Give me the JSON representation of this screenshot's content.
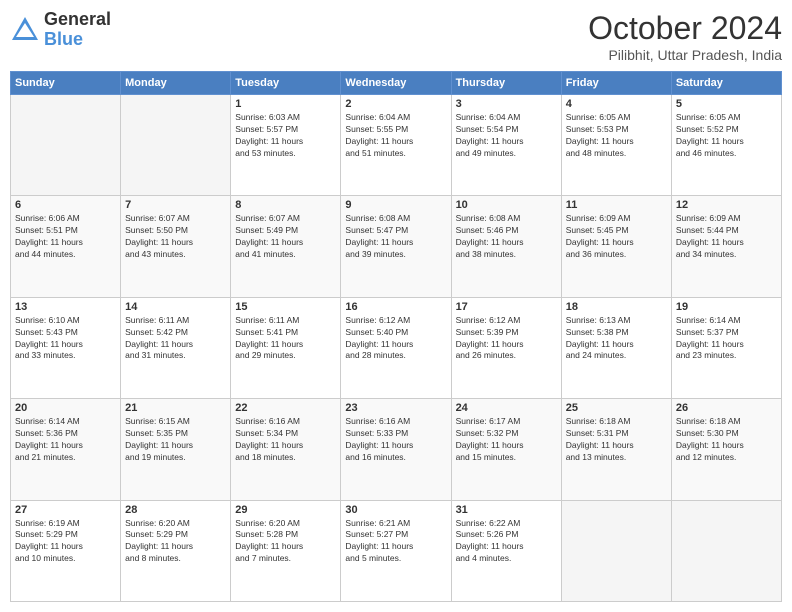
{
  "logo": {
    "general": "General",
    "blue": "Blue"
  },
  "title": "October 2024",
  "subtitle": "Pilibhit, Uttar Pradesh, India",
  "days": [
    "Sunday",
    "Monday",
    "Tuesday",
    "Wednesday",
    "Thursday",
    "Friday",
    "Saturday"
  ],
  "weeks": [
    [
      {
        "day": "",
        "empty": true
      },
      {
        "day": "",
        "empty": true
      },
      {
        "day": "1",
        "line1": "Sunrise: 6:03 AM",
        "line2": "Sunset: 5:57 PM",
        "line3": "Daylight: 11 hours",
        "line4": "and 53 minutes."
      },
      {
        "day": "2",
        "line1": "Sunrise: 6:04 AM",
        "line2": "Sunset: 5:55 PM",
        "line3": "Daylight: 11 hours",
        "line4": "and 51 minutes."
      },
      {
        "day": "3",
        "line1": "Sunrise: 6:04 AM",
        "line2": "Sunset: 5:54 PM",
        "line3": "Daylight: 11 hours",
        "line4": "and 49 minutes."
      },
      {
        "day": "4",
        "line1": "Sunrise: 6:05 AM",
        "line2": "Sunset: 5:53 PM",
        "line3": "Daylight: 11 hours",
        "line4": "and 48 minutes."
      },
      {
        "day": "5",
        "line1": "Sunrise: 6:05 AM",
        "line2": "Sunset: 5:52 PM",
        "line3": "Daylight: 11 hours",
        "line4": "and 46 minutes."
      }
    ],
    [
      {
        "day": "6",
        "line1": "Sunrise: 6:06 AM",
        "line2": "Sunset: 5:51 PM",
        "line3": "Daylight: 11 hours",
        "line4": "and 44 minutes."
      },
      {
        "day": "7",
        "line1": "Sunrise: 6:07 AM",
        "line2": "Sunset: 5:50 PM",
        "line3": "Daylight: 11 hours",
        "line4": "and 43 minutes."
      },
      {
        "day": "8",
        "line1": "Sunrise: 6:07 AM",
        "line2": "Sunset: 5:49 PM",
        "line3": "Daylight: 11 hours",
        "line4": "and 41 minutes."
      },
      {
        "day": "9",
        "line1": "Sunrise: 6:08 AM",
        "line2": "Sunset: 5:47 PM",
        "line3": "Daylight: 11 hours",
        "line4": "and 39 minutes."
      },
      {
        "day": "10",
        "line1": "Sunrise: 6:08 AM",
        "line2": "Sunset: 5:46 PM",
        "line3": "Daylight: 11 hours",
        "line4": "and 38 minutes."
      },
      {
        "day": "11",
        "line1": "Sunrise: 6:09 AM",
        "line2": "Sunset: 5:45 PM",
        "line3": "Daylight: 11 hours",
        "line4": "and 36 minutes."
      },
      {
        "day": "12",
        "line1": "Sunrise: 6:09 AM",
        "line2": "Sunset: 5:44 PM",
        "line3": "Daylight: 11 hours",
        "line4": "and 34 minutes."
      }
    ],
    [
      {
        "day": "13",
        "line1": "Sunrise: 6:10 AM",
        "line2": "Sunset: 5:43 PM",
        "line3": "Daylight: 11 hours",
        "line4": "and 33 minutes."
      },
      {
        "day": "14",
        "line1": "Sunrise: 6:11 AM",
        "line2": "Sunset: 5:42 PM",
        "line3": "Daylight: 11 hours",
        "line4": "and 31 minutes."
      },
      {
        "day": "15",
        "line1": "Sunrise: 6:11 AM",
        "line2": "Sunset: 5:41 PM",
        "line3": "Daylight: 11 hours",
        "line4": "and 29 minutes."
      },
      {
        "day": "16",
        "line1": "Sunrise: 6:12 AM",
        "line2": "Sunset: 5:40 PM",
        "line3": "Daylight: 11 hours",
        "line4": "and 28 minutes."
      },
      {
        "day": "17",
        "line1": "Sunrise: 6:12 AM",
        "line2": "Sunset: 5:39 PM",
        "line3": "Daylight: 11 hours",
        "line4": "and 26 minutes."
      },
      {
        "day": "18",
        "line1": "Sunrise: 6:13 AM",
        "line2": "Sunset: 5:38 PM",
        "line3": "Daylight: 11 hours",
        "line4": "and 24 minutes."
      },
      {
        "day": "19",
        "line1": "Sunrise: 6:14 AM",
        "line2": "Sunset: 5:37 PM",
        "line3": "Daylight: 11 hours",
        "line4": "and 23 minutes."
      }
    ],
    [
      {
        "day": "20",
        "line1": "Sunrise: 6:14 AM",
        "line2": "Sunset: 5:36 PM",
        "line3": "Daylight: 11 hours",
        "line4": "and 21 minutes."
      },
      {
        "day": "21",
        "line1": "Sunrise: 6:15 AM",
        "line2": "Sunset: 5:35 PM",
        "line3": "Daylight: 11 hours",
        "line4": "and 19 minutes."
      },
      {
        "day": "22",
        "line1": "Sunrise: 6:16 AM",
        "line2": "Sunset: 5:34 PM",
        "line3": "Daylight: 11 hours",
        "line4": "and 18 minutes."
      },
      {
        "day": "23",
        "line1": "Sunrise: 6:16 AM",
        "line2": "Sunset: 5:33 PM",
        "line3": "Daylight: 11 hours",
        "line4": "and 16 minutes."
      },
      {
        "day": "24",
        "line1": "Sunrise: 6:17 AM",
        "line2": "Sunset: 5:32 PM",
        "line3": "Daylight: 11 hours",
        "line4": "and 15 minutes."
      },
      {
        "day": "25",
        "line1": "Sunrise: 6:18 AM",
        "line2": "Sunset: 5:31 PM",
        "line3": "Daylight: 11 hours",
        "line4": "and 13 minutes."
      },
      {
        "day": "26",
        "line1": "Sunrise: 6:18 AM",
        "line2": "Sunset: 5:30 PM",
        "line3": "Daylight: 11 hours",
        "line4": "and 12 minutes."
      }
    ],
    [
      {
        "day": "27",
        "line1": "Sunrise: 6:19 AM",
        "line2": "Sunset: 5:29 PM",
        "line3": "Daylight: 11 hours",
        "line4": "and 10 minutes."
      },
      {
        "day": "28",
        "line1": "Sunrise: 6:20 AM",
        "line2": "Sunset: 5:29 PM",
        "line3": "Daylight: 11 hours",
        "line4": "and 8 minutes."
      },
      {
        "day": "29",
        "line1": "Sunrise: 6:20 AM",
        "line2": "Sunset: 5:28 PM",
        "line3": "Daylight: 11 hours",
        "line4": "and 7 minutes."
      },
      {
        "day": "30",
        "line1": "Sunrise: 6:21 AM",
        "line2": "Sunset: 5:27 PM",
        "line3": "Daylight: 11 hours",
        "line4": "and 5 minutes."
      },
      {
        "day": "31",
        "line1": "Sunrise: 6:22 AM",
        "line2": "Sunset: 5:26 PM",
        "line3": "Daylight: 11 hours",
        "line4": "and 4 minutes."
      },
      {
        "day": "",
        "empty": true
      },
      {
        "day": "",
        "empty": true
      }
    ]
  ]
}
